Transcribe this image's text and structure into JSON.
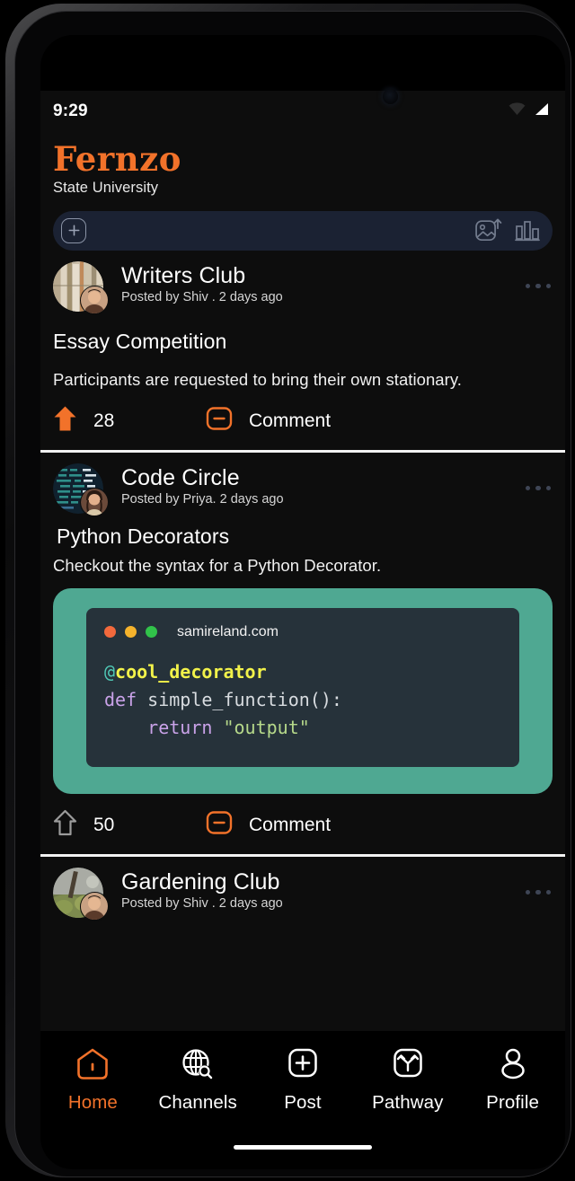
{
  "status_bar": {
    "time": "9:29",
    "icons": [
      "wifi-icon",
      "cellular-signal-icon"
    ]
  },
  "brand": {
    "logo": "Fernzo",
    "subtitle": "State University",
    "logo_color": "#F2722A"
  },
  "compose": {
    "add_icon": "plus-icon",
    "placeholder": "",
    "value": "",
    "tools": [
      {
        "icon": "image-upload-icon",
        "name": "image-upload"
      },
      {
        "icon": "poll-chart-icon",
        "name": "poll-chart"
      }
    ]
  },
  "feed": {
    "posts": [
      {
        "group": "Writers Club",
        "meta": "Posted by Shiv . 2 days ago",
        "title": "Essay Competition",
        "body": "Participants are requested to bring their own stationary.",
        "upvotes": "28",
        "upvoted": true,
        "comment_label": "Comment",
        "avatar": "writers-club-avatar",
        "user_avatar": "shiv-avatar"
      },
      {
        "group": "Code Circle",
        "meta": "Posted by Priya. 2 days ago",
        "title": "Python Decorators",
        "body": "Checkout the syntax for a Python Decorator.",
        "upvotes": "50",
        "upvoted": false,
        "comment_label": "Comment",
        "avatar": "code-circle-avatar",
        "user_avatar": "priya-avatar",
        "code_card": {
          "card_color": "#4fa892",
          "window_color": "#26323a",
          "host": "samireland.com",
          "dots": [
            "#f2693c",
            "#f5b32c",
            "#31c34a"
          ],
          "lines": [
            {
              "tokens": [
                {
                  "t": "@",
                  "c": "at"
                },
                {
                  "t": "cool_decorator",
                  "c": "dec"
                }
              ]
            },
            {
              "tokens": [
                {
                  "t": "def ",
                  "c": "kw"
                },
                {
                  "t": "simple_function():",
                  "c": "fn"
                }
              ]
            },
            {
              "tokens": [
                {
                  "t": "    ",
                  "c": "fn"
                },
                {
                  "t": "return ",
                  "c": "kw"
                },
                {
                  "t": "\"output\"",
                  "c": "str"
                }
              ]
            }
          ]
        }
      },
      {
        "group": "Gardening Club",
        "meta": "Posted by Shiv . 2 days ago",
        "avatar": "gardening-club-avatar",
        "user_avatar": "shiv-avatar"
      }
    ],
    "menu_icon": "more-options-icon"
  },
  "bottom_nav": {
    "active_color": "#F2722A",
    "items": [
      {
        "label": "Home",
        "icon": "home-icon",
        "active": true
      },
      {
        "label": "Channels",
        "icon": "globe-search-icon",
        "active": false
      },
      {
        "label": "Post",
        "icon": "plus-square-icon",
        "active": false
      },
      {
        "label": "Pathway",
        "icon": "pathway-branch-icon",
        "active": false
      },
      {
        "label": "Profile",
        "icon": "person-icon",
        "active": false
      }
    ]
  }
}
